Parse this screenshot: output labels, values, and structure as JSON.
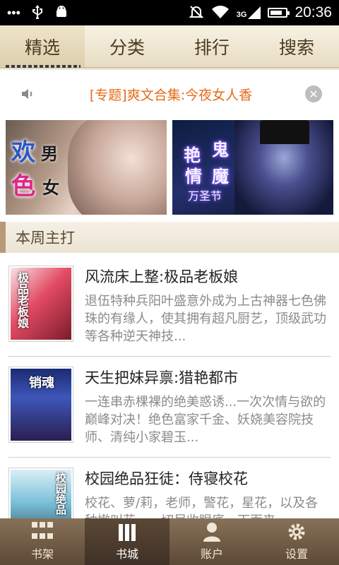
{
  "status_bar": {
    "left_icons": [
      "more-dots-icon",
      "usb-icon",
      "android-icon"
    ],
    "right_icons": [
      "silent-icon",
      "wifi-icon",
      "signal-3g-icon",
      "battery-icon"
    ],
    "network_label": "3G",
    "time": "20:36",
    "battery_level": 0.8
  },
  "top_tabs": {
    "items": [
      "精选",
      "分类",
      "排行",
      "搜索"
    ],
    "active_index": 0
  },
  "notice": {
    "text": "[专题]爽文合集:今夜女人香"
  },
  "banners": {
    "left": {
      "line1_big": "欢",
      "line1_small": "男",
      "line2_big": "色",
      "line2_small": "女"
    },
    "right": {
      "c1": "艳",
      "c2": "鬼",
      "c3": "情",
      "c4": "魔",
      "sub": "万圣节"
    }
  },
  "section": {
    "title": "本周主打"
  },
  "books": [
    {
      "title": "风流床上整:极品老板娘",
      "description": "退伍特种兵阳叶盛意外成为上古神器七色佛珠的有缘人，使其拥有超凡厨艺，顶级武功等各种逆天神技...",
      "cover_text": "极品老板娘"
    },
    {
      "title": "天生把妹异禀:猎艳都市",
      "description": "一连串赤棵裸的绝美惑诱...一次次情与欲的巅峰对决！绝色富家千金、妖娆美容院技师、清纯小家碧玉...",
      "cover_text": "销魂"
    },
    {
      "title": "校园绝品狂徒：侍寝校花",
      "description": "校花、萝/莉，老师，警花，星花，以及各种嫩叫花，一切尽收眼底。下面来...",
      "cover_text": "校园绝品"
    }
  ],
  "bottom_nav": {
    "items": [
      "书架",
      "书城",
      "账户",
      "设置"
    ],
    "active_index": 1
  }
}
